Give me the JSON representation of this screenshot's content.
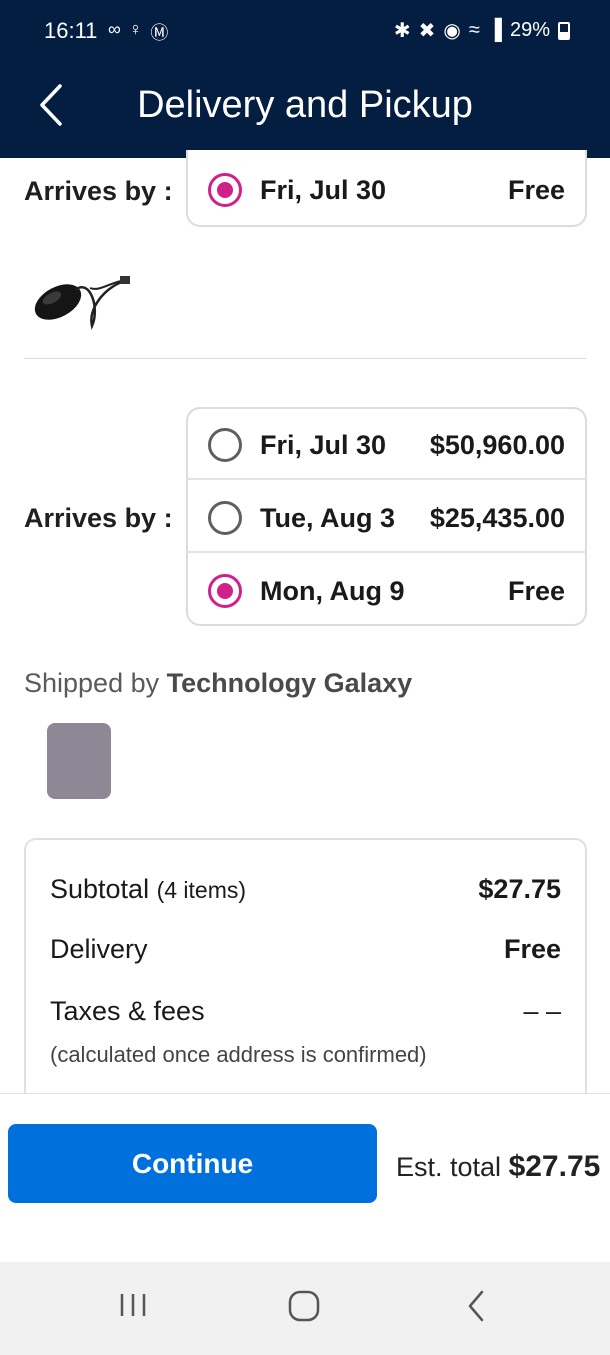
{
  "status_bar": {
    "time": "16:11",
    "battery": "29%",
    "left_icons": [
      "voicemail-icon",
      "person-icon",
      "malwarebytes-icon"
    ],
    "right_icons": [
      "bluetooth-icon",
      "mute-icon",
      "location-icon",
      "wifi-icon",
      "signal-icon"
    ]
  },
  "header": {
    "title": "Delivery and Pickup"
  },
  "item1": {
    "arrives_label": "Arrives by :",
    "option": {
      "date": "Fri, Jul 30",
      "price": "Free",
      "selected": true
    }
  },
  "item2": {
    "arrives_label": "Arrives by :",
    "options": [
      {
        "date": "Fri, Jul 30",
        "price": "$50,960.00",
        "selected": false
      },
      {
        "date": "Tue, Aug 3",
        "price": "$25,435.00",
        "selected": false
      },
      {
        "date": "Mon, Aug 9",
        "price": "Free",
        "selected": true
      }
    ]
  },
  "shipped": {
    "prefix": "Shipped by",
    "seller": "Technology Galaxy"
  },
  "summary": {
    "subtotal_label": "Subtotal",
    "subtotal_count": "(4 items)",
    "subtotal_value": "$27.75",
    "delivery_label": "Delivery",
    "delivery_value": "Free",
    "taxes_label": "Taxes & fees",
    "taxes_value": "– –",
    "taxes_note": "(calculated once address is confirmed)"
  },
  "footer": {
    "continue_label": "Continue",
    "est_label": "Est. total",
    "est_value": "$27.75"
  },
  "colors": {
    "header_bg": "#041e42",
    "accent_pink": "#d0208a",
    "button_blue": "#0071dc"
  }
}
